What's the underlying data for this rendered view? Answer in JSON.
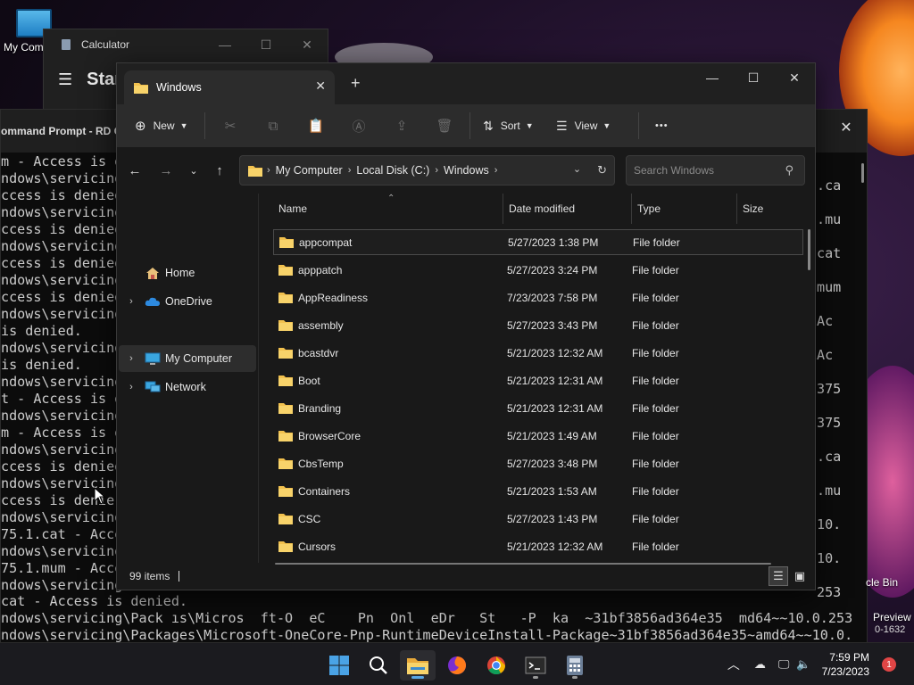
{
  "desktop": {
    "my_computer_label": "My Com",
    "recycle_bin_label": "cle Bin",
    "preview_label": "Preview",
    "preview_build": "0-1632"
  },
  "calculator": {
    "title": "Calculator",
    "header": "Star",
    "controls": [
      "—",
      "☐",
      "✕"
    ]
  },
  "cmd": {
    "title": "ommand Prompt - RD C",
    "close": "✕",
    "left_lines": [
      "m - Access is de",
      "ndows\\servicing",
      "ccess is denied",
      "ndows\\servicing",
      "ccess is denied",
      "ndows\\servicing",
      "ccess is denied.",
      "ndows\\servicing",
      "ccess is denied.",
      "ndows\\servicing",
      "is denied.",
      "ndows\\servicing",
      "is denied.",
      "ndows\\servicing",
      "t - Access is de",
      "ndows\\servicing",
      "m - Access is d",
      "ndows\\servicing",
      "ccess is denied",
      "ndows\\servicing",
      "ccess is denie",
      "ndows\\servicing",
      "75.1.cat - Acce",
      "ndows\\servicing",
      "75.1.mum - Acce",
      "ndows\\servicing"
    ],
    "right_lines": [
      ".ca",
      ".mu",
      "cat",
      "mum",
      "Ac",
      "Ac",
      "375",
      "375",
      ".ca",
      ".mu",
      "10.",
      "10.",
      "253"
    ],
    "bottom_lines": [
      "cat - Access is denied.",
      "ndows\\servicing\\Pack ıs\\Micros  ft-O  eC    Pn  Onl  eDr   St   -P  ka  ~31bf3856ad364e35  md64~~10.0.253",
      "ndows\\servicing\\Packages\\Microsoft-OneCore-Pnp-RuntimeDeviceInstall-Package~31bf3856ad364e35~amd64~~10.0."
    ]
  },
  "explorer": {
    "tab_title": "Windows",
    "tab_close": "✕",
    "new_tab": "+",
    "window_controls": [
      "—",
      "☐",
      "✕"
    ],
    "toolbar": {
      "new_label": "New",
      "sort_label": "Sort",
      "view_label": "View",
      "more_label": "•••"
    },
    "address": {
      "crumbs": [
        "My Computer",
        "Local Disk (C:)",
        "Windows"
      ]
    },
    "search": {
      "placeholder": "Search Windows"
    },
    "nav": {
      "home": "Home",
      "onedrive": "OneDrive",
      "my_computer": "My Computer",
      "network": "Network"
    },
    "columns": {
      "name": "Name",
      "date": "Date modified",
      "type": "Type",
      "size": "Size"
    },
    "rows": [
      {
        "name": "appcompat",
        "date": "5/27/2023 1:38 PM",
        "type": "File folder"
      },
      {
        "name": "apppatch",
        "date": "5/27/2023 3:24 PM",
        "type": "File folder"
      },
      {
        "name": "AppReadiness",
        "date": "7/23/2023 7:58 PM",
        "type": "File folder"
      },
      {
        "name": "assembly",
        "date": "5/27/2023 3:43 PM",
        "type": "File folder"
      },
      {
        "name": "bcastdvr",
        "date": "5/21/2023 12:32 AM",
        "type": "File folder"
      },
      {
        "name": "Boot",
        "date": "5/21/2023 12:31 AM",
        "type": "File folder"
      },
      {
        "name": "Branding",
        "date": "5/21/2023 12:31 AM",
        "type": "File folder"
      },
      {
        "name": "BrowserCore",
        "date": "5/21/2023 1:49 AM",
        "type": "File folder"
      },
      {
        "name": "CbsTemp",
        "date": "5/27/2023 3:48 PM",
        "type": "File folder"
      },
      {
        "name": "Containers",
        "date": "5/21/2023 1:53 AM",
        "type": "File folder"
      },
      {
        "name": "CSC",
        "date": "5/27/2023 1:43 PM",
        "type": "File folder"
      },
      {
        "name": "Cursors",
        "date": "5/21/2023 12:32 AM",
        "type": "File folder"
      }
    ],
    "status": {
      "item_count": "99 items"
    }
  },
  "taskbar": {
    "time": "7:59 PM",
    "date": "7/23/2023",
    "notification_count": "1"
  },
  "colors": {
    "folder": "#f2c14e",
    "accent": "#4aa3e6",
    "notif": "#e04545"
  }
}
